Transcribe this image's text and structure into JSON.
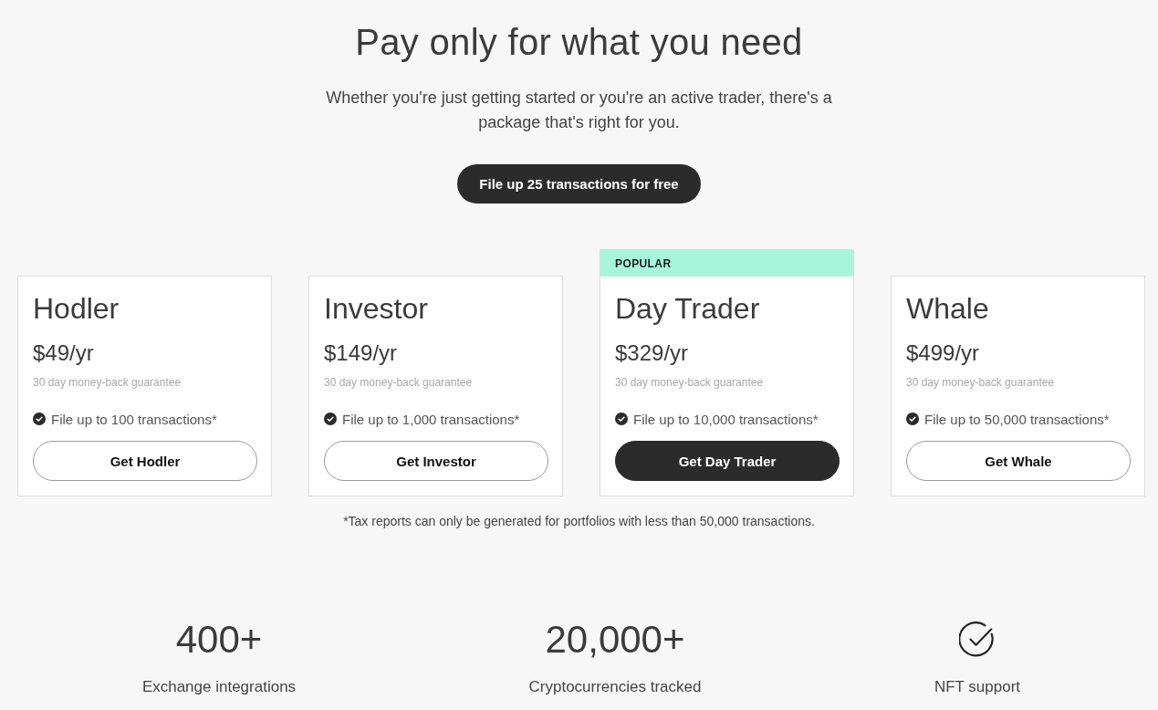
{
  "header": {
    "title": "Pay only for what you need",
    "subtitle": "Whether you're just getting started or you're an active trader, there's a package that's right for you.",
    "cta": "File up 25 transactions for free"
  },
  "plans": [
    {
      "name": "Hodler",
      "price": "$49/yr",
      "guarantee": "30 day money-back guarantee",
      "feature": "File up to 100 transactions*",
      "button": "Get Hodler",
      "featured": false
    },
    {
      "name": "Investor",
      "price": "$149/yr",
      "guarantee": "30 day money-back guarantee",
      "feature": "File up to 1,000 transactions*",
      "button": "Get Investor",
      "featured": false
    },
    {
      "name": "Day Trader",
      "price": "$329/yr",
      "guarantee": "30 day money-back guarantee",
      "feature": "File up to 10,000 transactions*",
      "button": "Get Day Trader",
      "featured": true,
      "badge": "POPULAR"
    },
    {
      "name": "Whale",
      "price": "$499/yr",
      "guarantee": "30 day money-back guarantee",
      "feature": "File up to 50,000 transactions*",
      "button": "Get Whale",
      "featured": false
    }
  ],
  "footnote": "*Tax reports can only be generated for portfolios with less than 50,000 transactions.",
  "stats": [
    {
      "kind": "number",
      "value": "400+",
      "label": "Exchange integrations"
    },
    {
      "kind": "number",
      "value": "20,000+",
      "label": "Cryptocurrencies tracked"
    },
    {
      "kind": "icon",
      "label": "NFT support"
    }
  ]
}
